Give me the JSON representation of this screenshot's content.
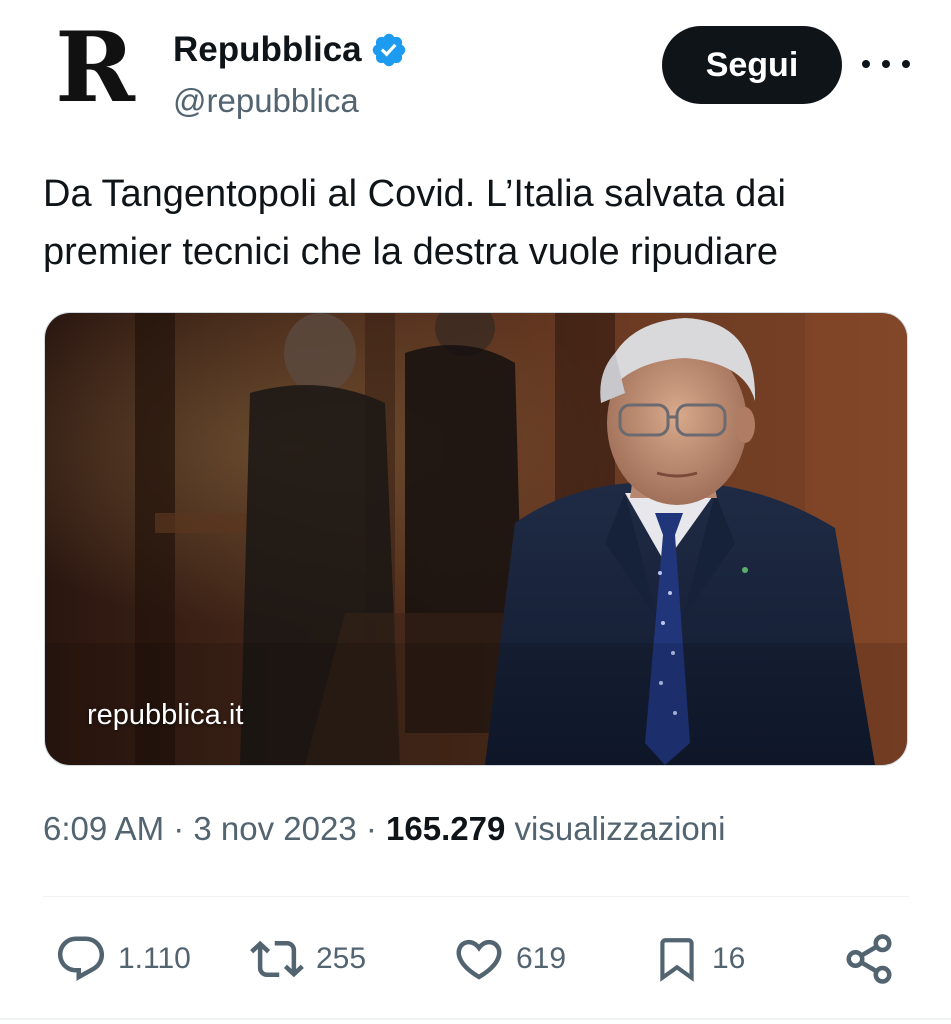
{
  "account": {
    "avatar_letter": "R",
    "name": "Repubblica",
    "handle": "@repubblica",
    "verified": true,
    "verified_color": "#1d9bf0"
  },
  "follow_button": {
    "label": "Segui"
  },
  "more_menu": {
    "icon": "more-horizontal-icon"
  },
  "tweet": {
    "text": "Da Tangentopoli al Covid. L’Italia salvata dai premier tecnici che la destra vuole ripudiare"
  },
  "media_card": {
    "domain": "repubblica.it"
  },
  "meta": {
    "time": "6:09 AM",
    "sep1": " · ",
    "date": "3 nov 2023",
    "sep2": " · ",
    "views": "165.279",
    "views_label": " visualizzazioni"
  },
  "actions": {
    "replies": "1.110",
    "retweets": "255",
    "likes": "619",
    "bookmarks": "16"
  },
  "colors": {
    "text_primary": "#0f1419",
    "text_secondary": "#536471",
    "accent": "#1d9bf0"
  }
}
